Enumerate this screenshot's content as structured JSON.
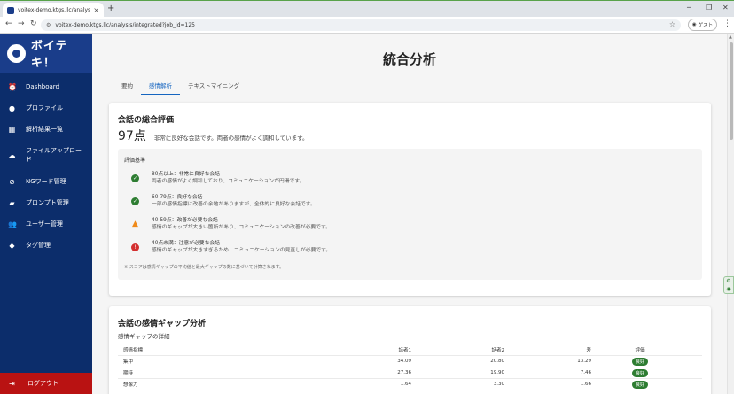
{
  "browser": {
    "tab_title": "voitex-demo.ktgs.llc/analysis/c",
    "url": "voitex-demo.ktgs.llc/analysis/integrated?job_id=125",
    "profile_label": "ゲスト"
  },
  "sidebar": {
    "logo_text": "ボイテキ！",
    "items": [
      {
        "label": "Dashboard",
        "icon": "alarm-icon"
      },
      {
        "label": "プロファイル",
        "icon": "person-icon"
      },
      {
        "label": "解析結果一覧",
        "icon": "grid-icon"
      },
      {
        "label": "ファイルアップロード",
        "icon": "cloud-upload-icon"
      },
      {
        "label": "NGワード管理",
        "icon": "block-icon"
      },
      {
        "label": "プロンプト管理",
        "icon": "chat-icon"
      },
      {
        "label": "ユーザー管理",
        "icon": "group-icon"
      },
      {
        "label": "タグ管理",
        "icon": "tag-icon"
      }
    ],
    "logout_label": "ログアウト"
  },
  "main": {
    "title": "統合分析",
    "tabs": [
      {
        "label": "要約",
        "active": false
      },
      {
        "label": "感情解析",
        "active": true
      },
      {
        "label": "テキストマイニング",
        "active": false
      }
    ]
  },
  "overall": {
    "title": "会話の総合評価",
    "score": "97点",
    "description": "非常に良好な会話です。両者の感情がよく調和しています。",
    "criteria_heading": "評価基準",
    "criteria": [
      {
        "title": "80点以上：非常に良好な会話",
        "desc": "両者の感情がよく調和しており、コミュニケーションが円滑です。",
        "icon": "check-circle-icon",
        "color": "#2e7d32"
      },
      {
        "title": "60-79点：良好な会話",
        "desc": "一部の感情指標に改善の余地がありますが、全体的に良好な会話です。",
        "icon": "check-circle-icon",
        "color": "#2e7d32"
      },
      {
        "title": "40-59点：改善が必要な会話",
        "desc": "感情のギャップが大きい箇所があり、コミュニケーションの改善が必要です。",
        "icon": "warning-icon",
        "color": "#ef8a1a"
      },
      {
        "title": "40点未満：注意が必要な会話",
        "desc": "感情のギャップが大きすぎるため、コミュニケーションの見直しが必要です。",
        "icon": "error-icon",
        "color": "#d32f2f"
      }
    ],
    "note": "※ スコアは感情ギャップの平均値と最大ギャップの数に基づいて計算されます。"
  },
  "gap": {
    "title": "会話の感情ギャップ分析",
    "subtitle": "感情ギャップの詳細",
    "headers": [
      "感情指標",
      "話者1",
      "話者2",
      "差",
      "評価"
    ],
    "rows": [
      {
        "name": "集中",
        "s1": "34.09",
        "s2": "20.80",
        "diff": "13.29",
        "rating": "良好"
      },
      {
        "name": "期待",
        "s1": "27.36",
        "s2": "19.90",
        "diff": "7.46",
        "rating": "良好"
      },
      {
        "name": "想像力",
        "s1": "1.64",
        "s2": "3.30",
        "diff": "1.66",
        "rating": "良好"
      }
    ]
  },
  "colors": {
    "sidebar_bg": "#0c2d6b",
    "logo_bg": "#1a3d8a",
    "logout_bg": "#b91212",
    "accent": "#1565c0",
    "good_badge": "#2e7d32"
  }
}
